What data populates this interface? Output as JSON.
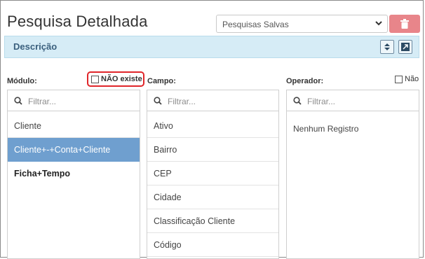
{
  "header": {
    "title": "Pesquisa Detalhada",
    "saved_searches": "Pesquisas Salvas"
  },
  "description_bar": {
    "label": "Descrição"
  },
  "modulo": {
    "label": "Módulo:",
    "not_exists_label": "NÃO existe",
    "filter_placeholder": "Filtrar...",
    "items": [
      "Cliente",
      "Cliente+-+Conta+Cliente",
      "Ficha+Tempo"
    ],
    "selected_index": 1
  },
  "campo": {
    "label": "Campo:",
    "filter_placeholder": "Filtrar...",
    "items": [
      "Ativo",
      "Bairro",
      "CEP",
      "Cidade",
      "Classificação Cliente",
      "Código"
    ]
  },
  "operador": {
    "label": "Operador:",
    "nao_label": "Não",
    "filter_placeholder": "Filtrar...",
    "empty_text": "Nenhum Registro"
  },
  "colors": {
    "delete_button": "#e8858a",
    "description_bar": "#d6ecf6",
    "selected_item": "#6f9fcf",
    "highlight_box": "#e0262a"
  }
}
